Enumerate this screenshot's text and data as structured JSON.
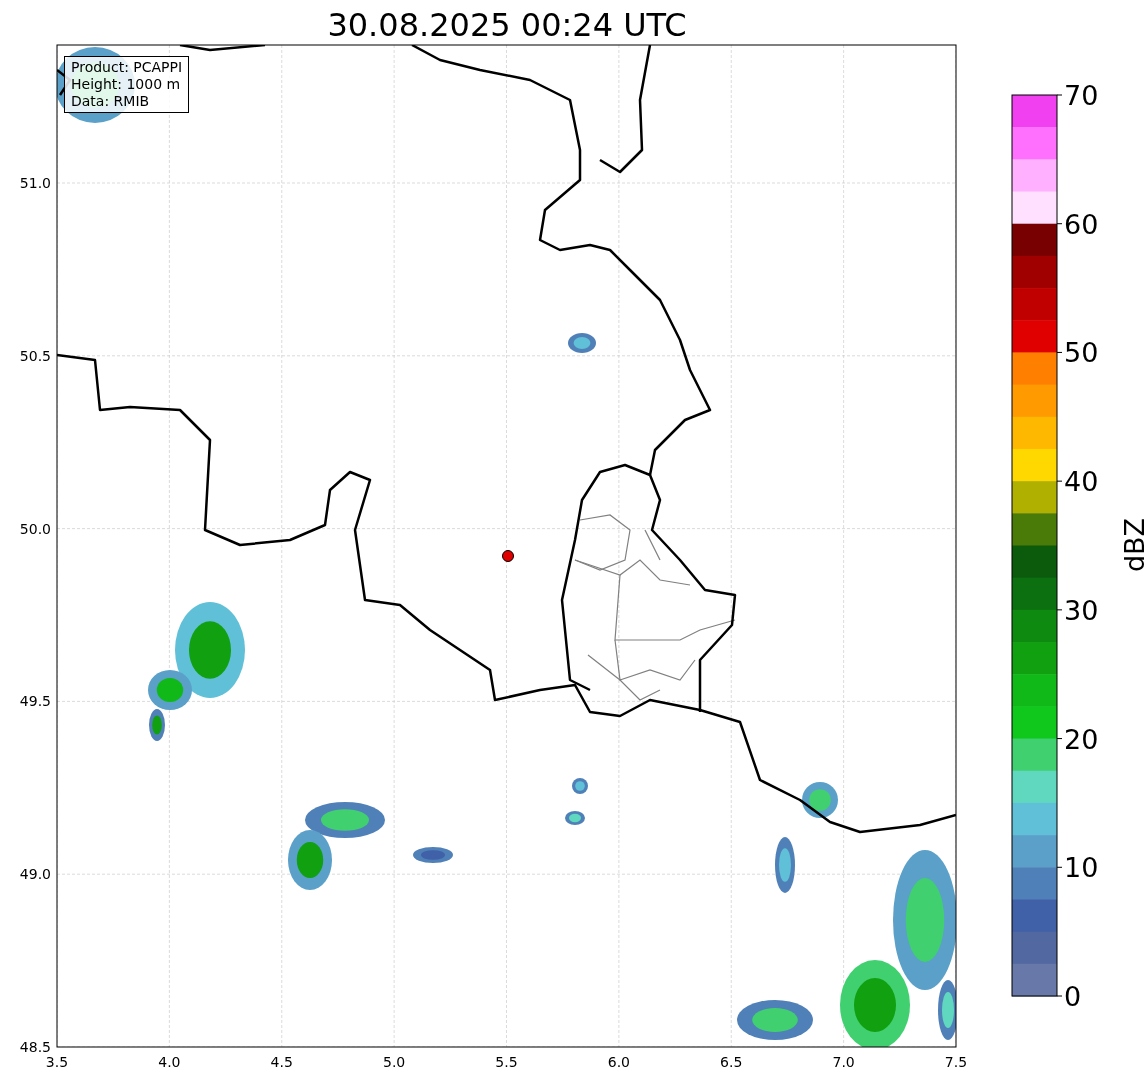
{
  "title": "30.08.2025 00:24 UTC",
  "info_box": [
    "Product: PCAPPI",
    "Height: 1000 m",
    "Data: RMIB"
  ],
  "map": {
    "xticks": [
      "3.5",
      "4.0",
      "4.5",
      "5.0",
      "5.5",
      "6.0",
      "6.5",
      "7.0",
      "7.5"
    ],
    "yticks": [
      "51.0",
      "50.5",
      "50.0",
      "49.5",
      "49.0",
      "48.5"
    ]
  },
  "colorbar": {
    "label": "dBZ",
    "ticks": [
      "70",
      "60",
      "50",
      "40",
      "30",
      "20",
      "10",
      "0"
    ],
    "bins": [
      {
        "color": "#f040f0"
      },
      {
        "color": "#ff70ff"
      },
      {
        "color": "#ffb0ff"
      },
      {
        "color": "#ffe0ff"
      },
      {
        "color": "#780000"
      },
      {
        "color": "#a00000"
      },
      {
        "color": "#c00000"
      },
      {
        "color": "#e00000"
      },
      {
        "color": "#ff7f00"
      },
      {
        "color": "#ff9a00"
      },
      {
        "color": "#ffb800"
      },
      {
        "color": "#ffd800"
      },
      {
        "color": "#b0b000"
      },
      {
        "color": "#4a7a08"
      },
      {
        "color": "#0c5a0c"
      },
      {
        "color": "#0c7010"
      },
      {
        "color": "#0e8a10"
      },
      {
        "color": "#10a010"
      },
      {
        "color": "#10b818"
      },
      {
        "color": "#10c81c"
      },
      {
        "color": "#40d070"
      },
      {
        "color": "#60d8c0"
      },
      {
        "color": "#60c0d8"
      },
      {
        "color": "#5aa0c8"
      },
      {
        "color": "#5080b8"
      },
      {
        "color": "#4060a8"
      },
      {
        "color": "#5268a0"
      },
      {
        "color": "#6878a8"
      }
    ]
  }
}
